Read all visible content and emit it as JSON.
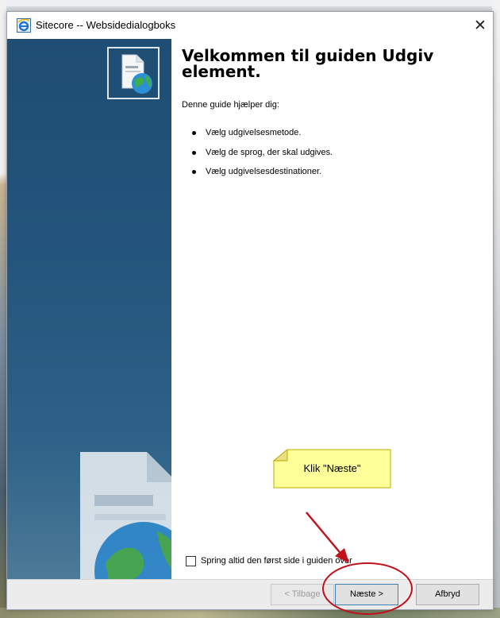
{
  "dialog": {
    "title": "Sitecore -- Websidedialogboks",
    "close_symbol": "✕"
  },
  "wizard": {
    "heading": "Velkommen til guiden Udgiv element.",
    "intro": "Denne guide hjælper dig:",
    "bullets": [
      "Vælg udgivelsesmetode.",
      "Vælg de sprog, der skal udgives.",
      "Vælg udgivelsesdestinationer."
    ],
    "skip_checkbox": {
      "label": "Spring altid den først side i guiden over",
      "checked": false
    }
  },
  "buttons": {
    "back": "< Tilbage",
    "next": "Næste >",
    "cancel": "Afbryd"
  },
  "annotation": {
    "callout_text": "Klik \"Næste\"",
    "callout_color": "#ffff99",
    "highlight_color": "#c0121b"
  },
  "icons": {
    "title": "ie-icon",
    "wizard": "publish-page-icon"
  },
  "colors": {
    "sidebar": "#24557c",
    "next_border": "#3c7fb1"
  }
}
